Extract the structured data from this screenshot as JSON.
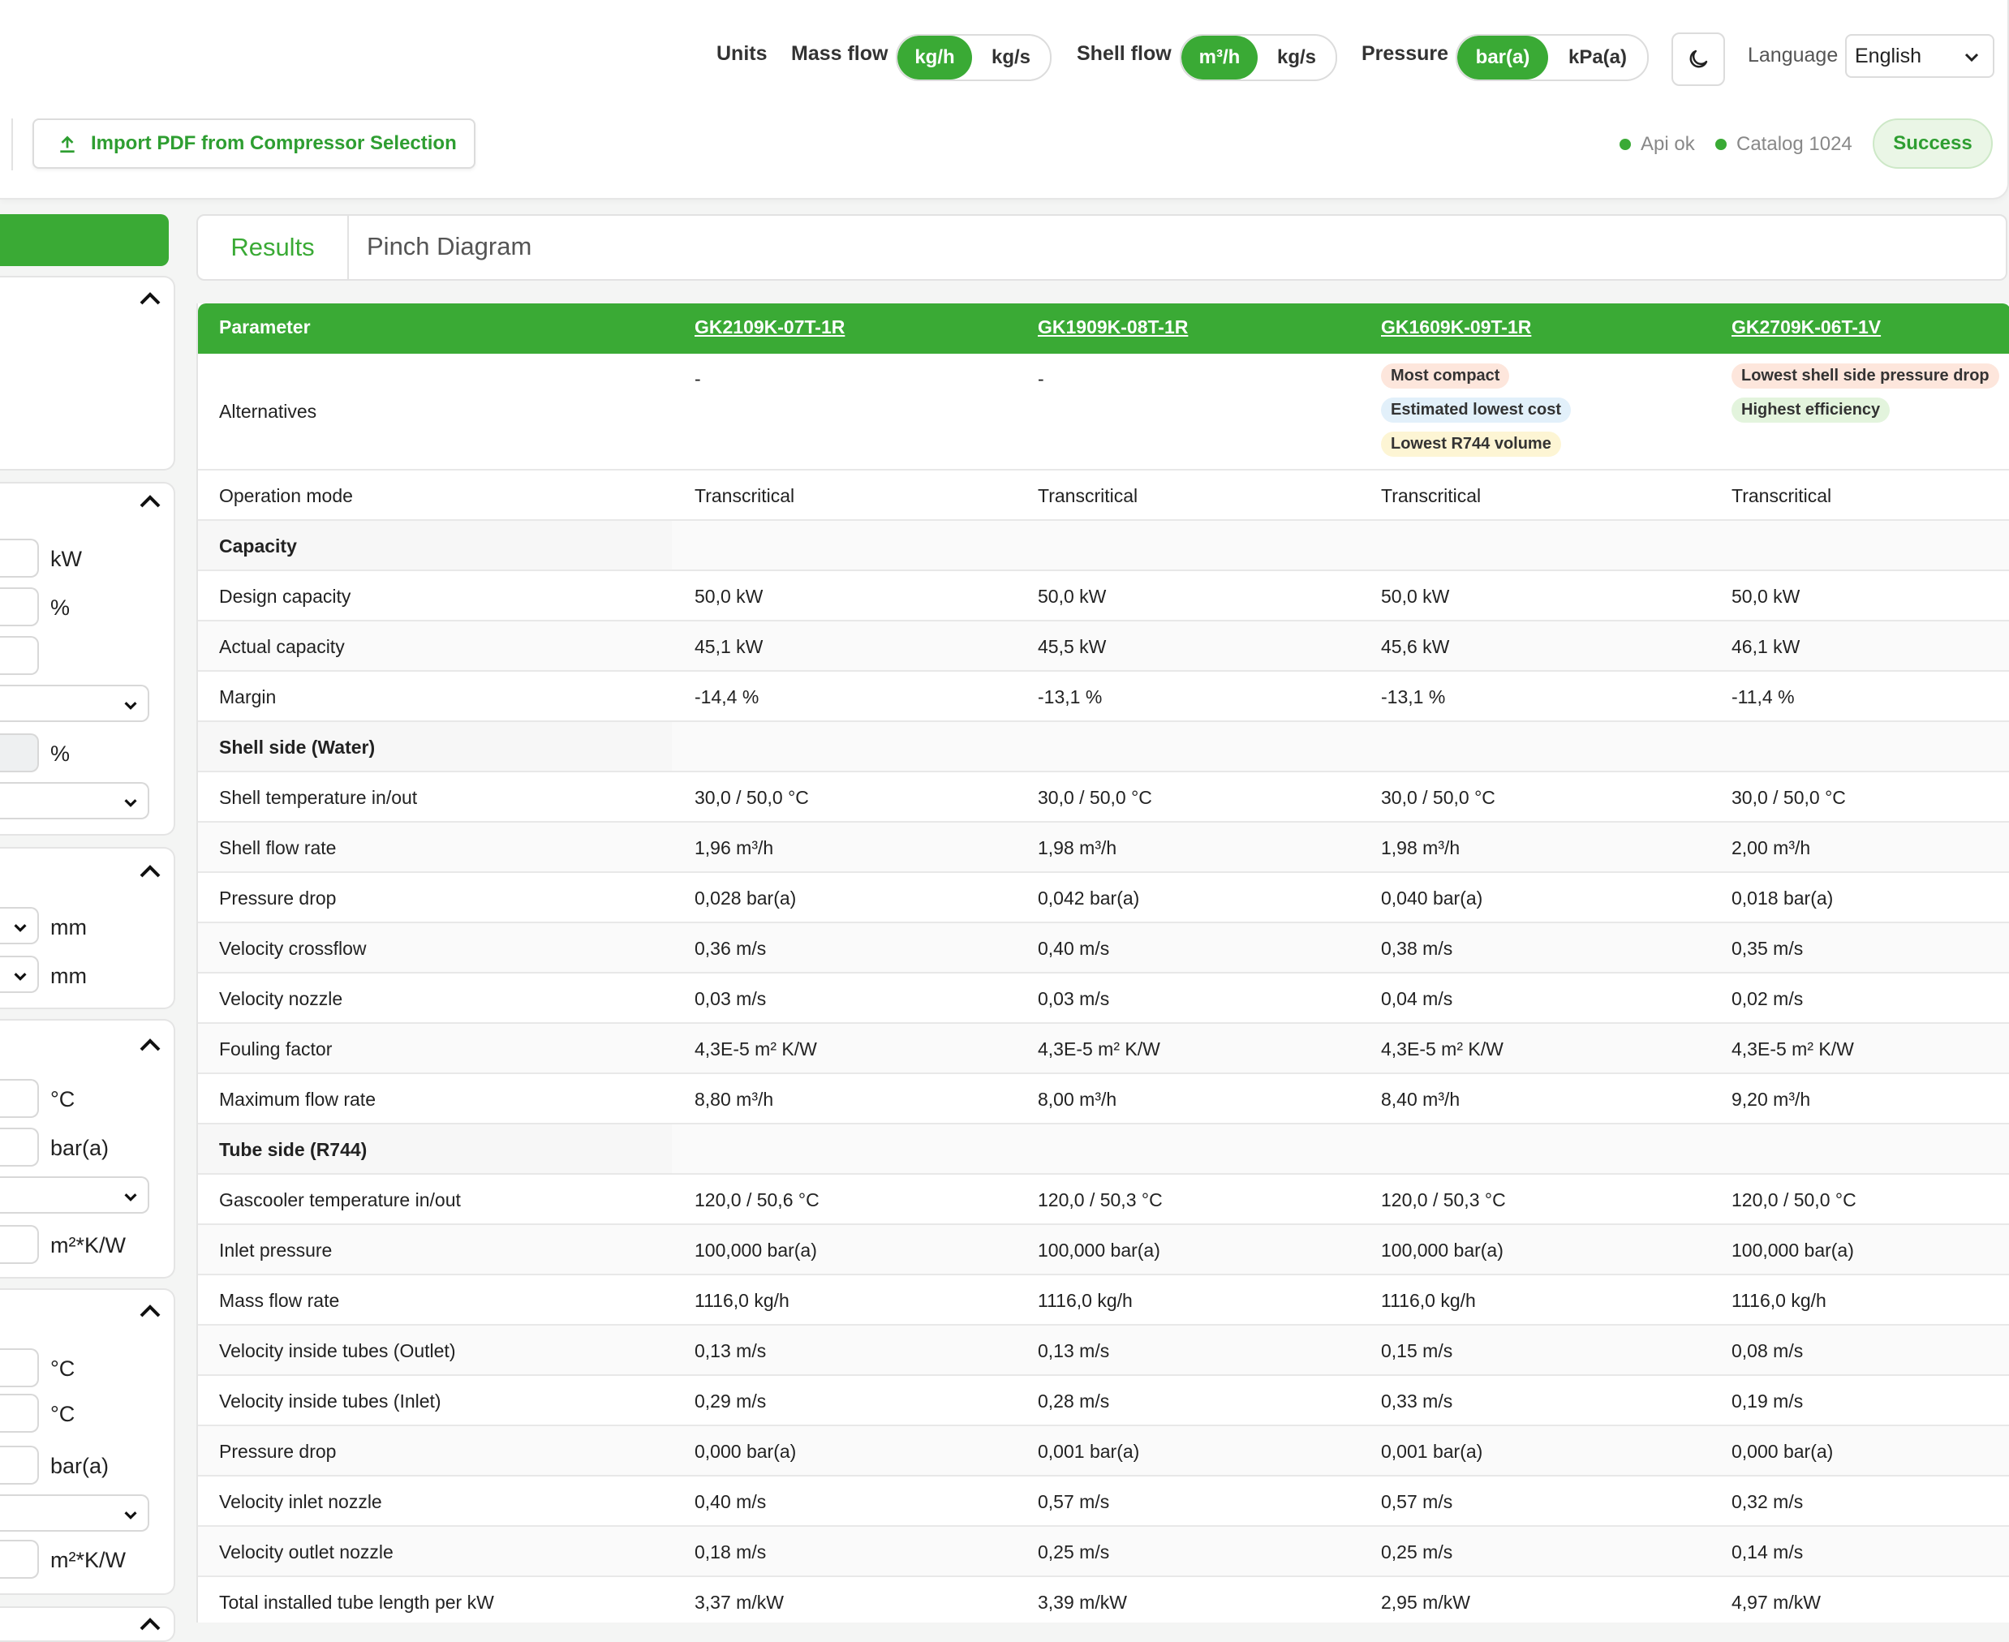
{
  "header": {
    "units_label": "Units",
    "mass_flow": {
      "label": "Mass flow",
      "options": [
        "kg/h",
        "kg/s"
      ],
      "selected": "kg/h"
    },
    "shell_flow": {
      "label": "Shell flow",
      "options": [
        "m³/h",
        "kg/s"
      ],
      "selected": "m³/h"
    },
    "pressure": {
      "label": "Pressure",
      "options": [
        "bar(a)",
        "kPa(a)"
      ],
      "selected": "bar(a)"
    },
    "language_label": "Language",
    "language_value": "English",
    "import_button": "Import PDF from Compressor Selection",
    "status": {
      "api": "Api ok",
      "catalog": "Catalog 1024",
      "result": "Success"
    },
    "colors": {
      "accent": "#3aaa35",
      "status_ok": "#3aaa35"
    }
  },
  "sidebar_units": [
    "kW",
    "%",
    "%",
    "mm",
    "mm",
    "°C",
    "bar(a)",
    "m²*K/W",
    "°C",
    "°C",
    "bar(a)",
    "m²*K/W"
  ],
  "tabs": {
    "results": "Results",
    "pinch": "Pinch Diagram"
  },
  "table": {
    "header": [
      "Parameter",
      "GK2109K-07T-1R",
      "GK1909K-08T-1R",
      "GK1609K-09T-1R",
      "GK2709K-06T-1V"
    ],
    "alternatives": {
      "label": "Alternatives",
      "col1": "-",
      "col2": "-",
      "col3": [
        "Most compact",
        "Estimated lowest cost",
        "Lowest R744 volume"
      ],
      "col4": [
        "Lowest shell side pressure drop",
        "Highest efficiency"
      ]
    },
    "rows": [
      {
        "label": "Operation mode",
        "values": [
          "Transcritical",
          "Transcritical",
          "Transcritical",
          "Transcritical"
        ]
      },
      {
        "label": "Capacity",
        "section": true
      },
      {
        "label": "Design capacity",
        "values": [
          "50,0 kW",
          "50,0 kW",
          "50,0 kW",
          "50,0 kW"
        ]
      },
      {
        "label": "Actual capacity",
        "values": [
          "45,1 kW",
          "45,5 kW",
          "45,6 kW",
          "46,1 kW"
        ]
      },
      {
        "label": "Margin",
        "values": [
          "-14,4 %",
          "-13,1 %",
          "-13,1 %",
          "-11,4 %"
        ]
      },
      {
        "label": "Shell side (Water)",
        "section": true
      },
      {
        "label": "Shell temperature in/out",
        "values": [
          "30,0 / 50,0 °C",
          "30,0 / 50,0 °C",
          "30,0 / 50,0 °C",
          "30,0 / 50,0 °C"
        ]
      },
      {
        "label": "Shell flow rate",
        "values": [
          "1,96 m³/h",
          "1,98 m³/h",
          "1,98 m³/h",
          "2,00 m³/h"
        ]
      },
      {
        "label": "Pressure drop",
        "values": [
          "0,028 bar(a)",
          "0,042 bar(a)",
          "0,040 bar(a)",
          "0,018 bar(a)"
        ]
      },
      {
        "label": "Velocity crossflow",
        "values": [
          "0,36 m/s",
          "0,40 m/s",
          "0,38 m/s",
          "0,35 m/s"
        ]
      },
      {
        "label": "Velocity nozzle",
        "values": [
          "0,03 m/s",
          "0,03 m/s",
          "0,04 m/s",
          "0,02 m/s"
        ]
      },
      {
        "label": "Fouling factor",
        "values": [
          "4,3E-5 m² K/W",
          "4,3E-5 m² K/W",
          "4,3E-5 m² K/W",
          "4,3E-5 m² K/W"
        ]
      },
      {
        "label": "Maximum flow rate",
        "values": [
          "8,80 m³/h",
          "8,00 m³/h",
          "8,40 m³/h",
          "9,20 m³/h"
        ]
      },
      {
        "label": "Tube side (R744)",
        "section": true
      },
      {
        "label": "Gascooler temperature in/out",
        "values": [
          "120,0 / 50,6 °C",
          "120,0 / 50,3 °C",
          "120,0 / 50,3 °C",
          "120,0 / 50,0 °C"
        ]
      },
      {
        "label": "Inlet pressure",
        "values": [
          "100,000 bar(a)",
          "100,000 bar(a)",
          "100,000 bar(a)",
          "100,000 bar(a)"
        ]
      },
      {
        "label": "Mass flow rate",
        "values": [
          "1116,0 kg/h",
          "1116,0 kg/h",
          "1116,0 kg/h",
          "1116,0 kg/h"
        ]
      },
      {
        "label": "Velocity inside tubes (Outlet)",
        "values": [
          "0,13 m/s",
          "0,13 m/s",
          "0,15 m/s",
          "0,08 m/s"
        ]
      },
      {
        "label": "Velocity inside tubes (Inlet)",
        "values": [
          "0,29 m/s",
          "0,28 m/s",
          "0,33 m/s",
          "0,19 m/s"
        ]
      },
      {
        "label": "Pressure drop",
        "values": [
          "0,000 bar(a)",
          "0,001 bar(a)",
          "0,001 bar(a)",
          "0,000 bar(a)"
        ]
      },
      {
        "label": "Velocity inlet nozzle",
        "values": [
          "0,40 m/s",
          "0,57 m/s",
          "0,57 m/s",
          "0,32 m/s"
        ]
      },
      {
        "label": "Velocity outlet nozzle",
        "values": [
          "0,18 m/s",
          "0,25 m/s",
          "0,25 m/s",
          "0,14 m/s"
        ]
      },
      {
        "label": "Total installed tube length per kW",
        "values": [
          "3,37 m/kW",
          "3,39 m/kW",
          "2,95 m/kW",
          "4,97 m/kW"
        ]
      }
    ]
  }
}
